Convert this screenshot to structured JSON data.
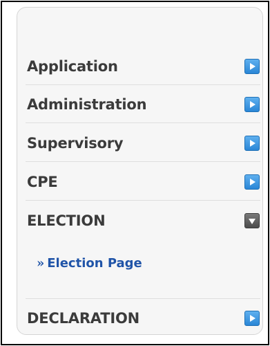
{
  "menu": {
    "items": [
      {
        "label": "Application",
        "icon": "arrow-right-icon",
        "state": "collapsed"
      },
      {
        "label": "Administration",
        "icon": "arrow-right-icon",
        "state": "collapsed"
      },
      {
        "label": "Supervisory",
        "icon": "arrow-right-icon",
        "state": "collapsed"
      },
      {
        "label": "CPE",
        "icon": "arrow-right-icon",
        "state": "collapsed"
      },
      {
        "label": "ELECTION",
        "icon": "arrow-down-icon",
        "state": "expanded"
      },
      {
        "label": "DECLARATION",
        "icon": "arrow-right-icon",
        "state": "collapsed"
      }
    ],
    "submenu": {
      "marker": "»",
      "link_label": "Election Page"
    }
  },
  "colors": {
    "label": "#3b3b3b",
    "link": "#2054a8",
    "arrow_blue": "#2a86d6",
    "arrow_gray": "#4c4c4c",
    "panel_bg": "#f6f6f6"
  }
}
